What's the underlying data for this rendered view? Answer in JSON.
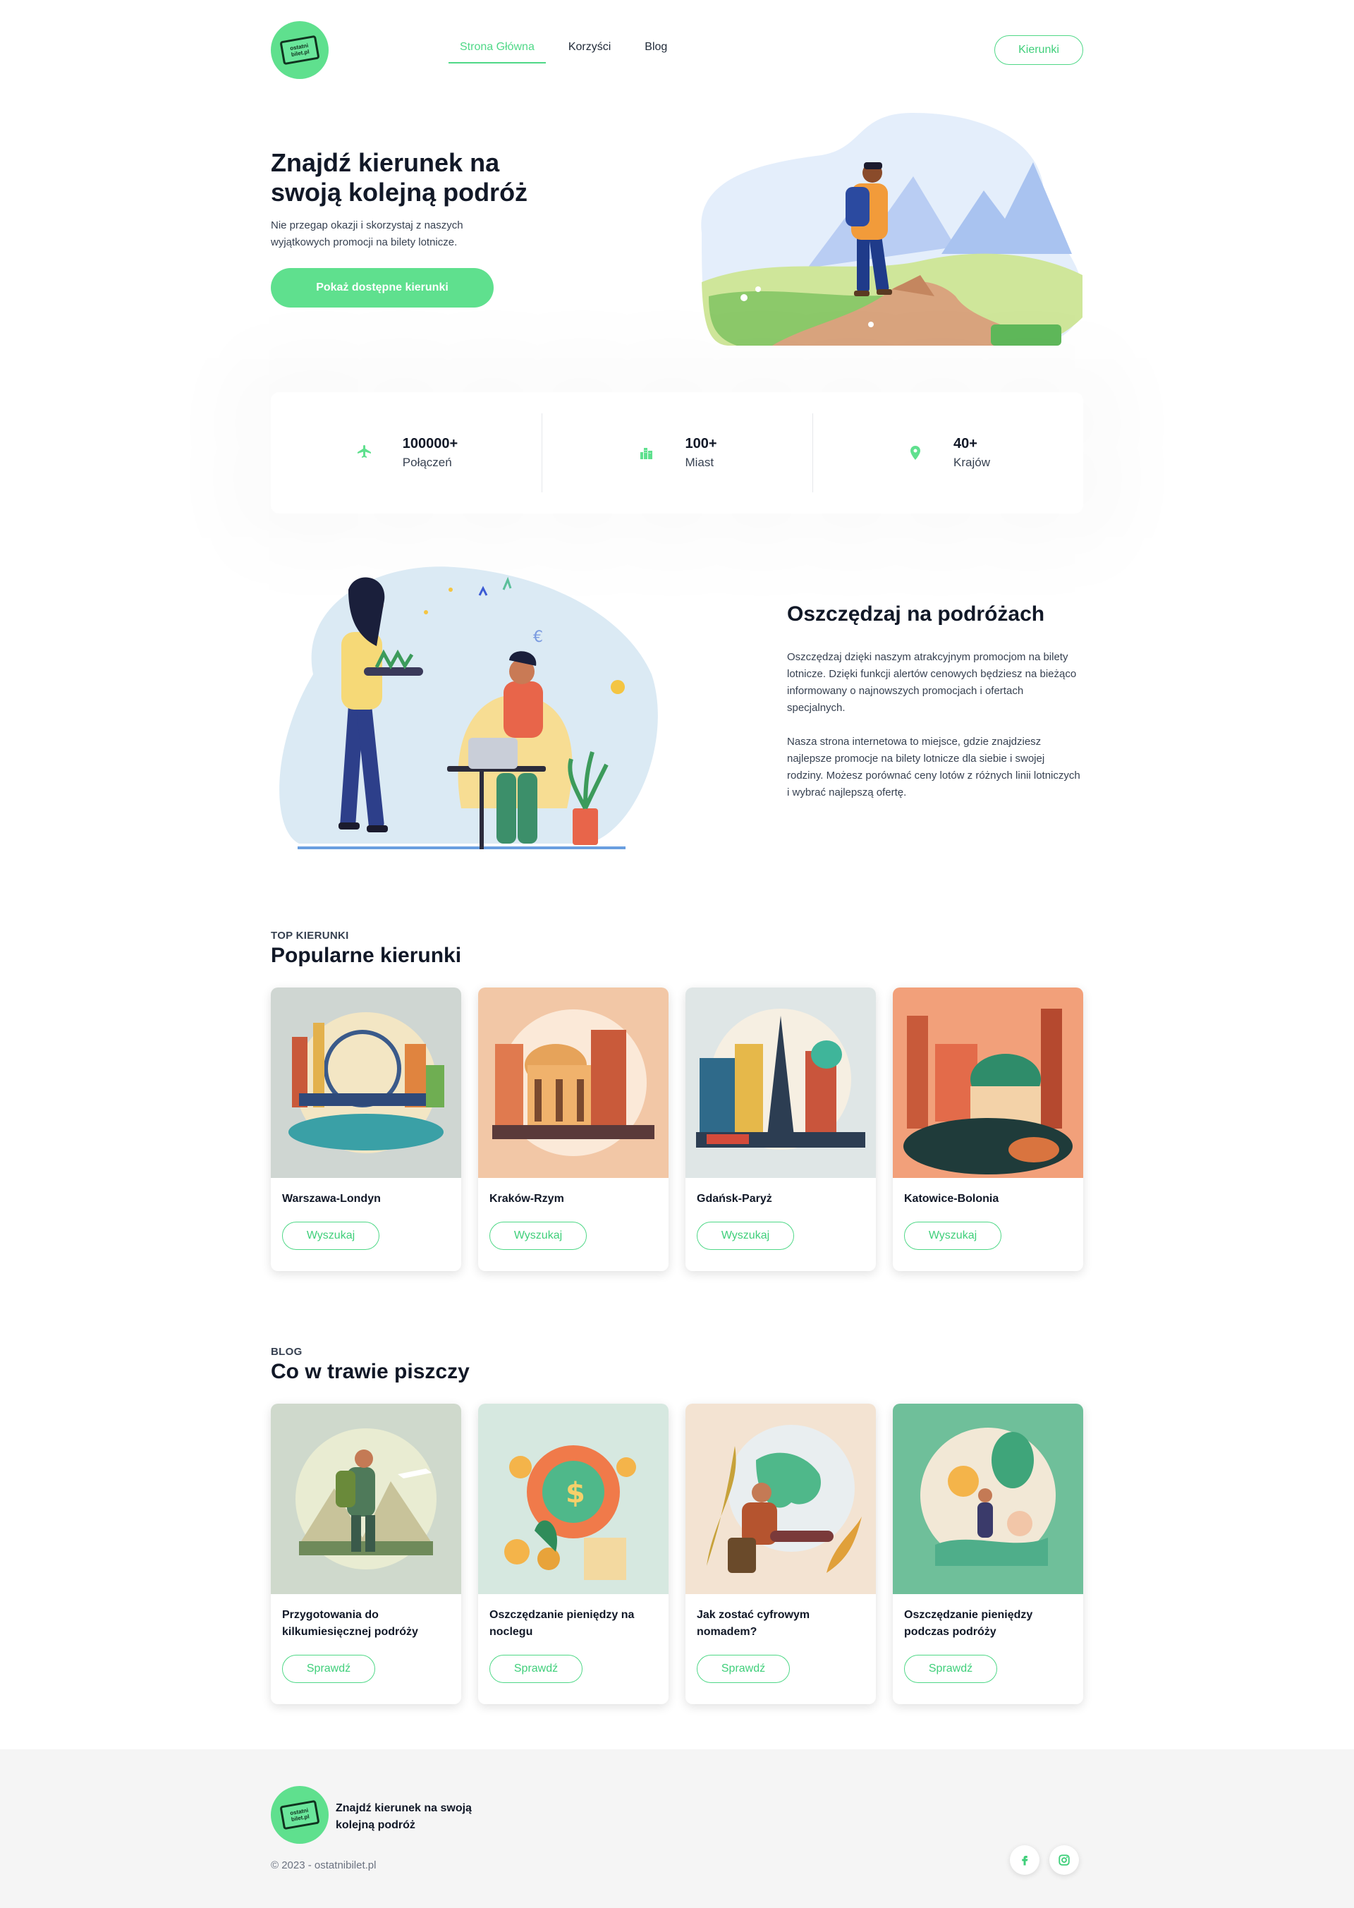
{
  "brand": {
    "logo_line1": "ostatni",
    "logo_line2": "bilet.pl"
  },
  "nav": {
    "items": [
      {
        "label": "Strona Główna",
        "active": true
      },
      {
        "label": "Korzyści",
        "active": false
      },
      {
        "label": "Blog",
        "active": false
      }
    ],
    "cta_label": "Kierunki"
  },
  "hero": {
    "title": "Znajdź kierunek na swoją kolejną podróż",
    "subtitle": "Nie przegap okazji i skorzystaj z naszych wyjątkowych promocji na bilety lotnicze.",
    "button_label": "Pokaż dostępne kierunki"
  },
  "stats": [
    {
      "icon": "plane-icon",
      "value": "100000+",
      "label": "Połączeń"
    },
    {
      "icon": "city-icon",
      "value": "100+",
      "label": "Miast"
    },
    {
      "icon": "location-pin-icon",
      "value": "40+",
      "label": "Krajów"
    }
  ],
  "savings": {
    "title": "Oszczędzaj na podróżach",
    "p1": "Oszczędzaj dzięki naszym atrakcyjnym promocjom na bilety lotnicze. Dzięki funkcji alertów cenowych będziesz na bieżąco informowany o najnowszych promocjach i ofertach specjalnych.",
    "p2": "Nasza strona internetowa to miejsce, gdzie znajdziesz najlepsze promocje na bilety lotnicze dla siebie i swojej rodziny. Możesz porównać ceny lotów z różnych linii lotniczych i wybrać najlepszą ofertę."
  },
  "destinations": {
    "eyebrow": "TOP KIERUNKI",
    "title": "Popularne kierunki",
    "button_label": "Wyszukaj",
    "items": [
      {
        "route": "Warszawa-Londyn"
      },
      {
        "route": "Kraków-Rzym"
      },
      {
        "route": "Gdańsk-Paryż"
      },
      {
        "route": "Katowice-Bolonia"
      }
    ]
  },
  "blog": {
    "eyebrow": "BLOG",
    "title": "Co w trawie piszczy",
    "button_label": "Sprawdź",
    "items": [
      {
        "title": "Przygotowania do kilkumiesięcznej podróży"
      },
      {
        "title": "Oszczędzanie pieniędzy na noclegu"
      },
      {
        "title": "Jak zostać cyfrowym nomadem?"
      },
      {
        "title": "Oszczędzanie pieniędzy podczas podróży"
      }
    ]
  },
  "footer": {
    "tagline": "Znajdź kierunek na swoją kolejną podróż",
    "copyright": "© 2023 - ostatnibilet.pl",
    "social": [
      "facebook-icon",
      "instagram-icon"
    ]
  },
  "colors": {
    "accent": "#5fe08e",
    "accent_text": "#3fcf7a",
    "text": "#111827"
  }
}
